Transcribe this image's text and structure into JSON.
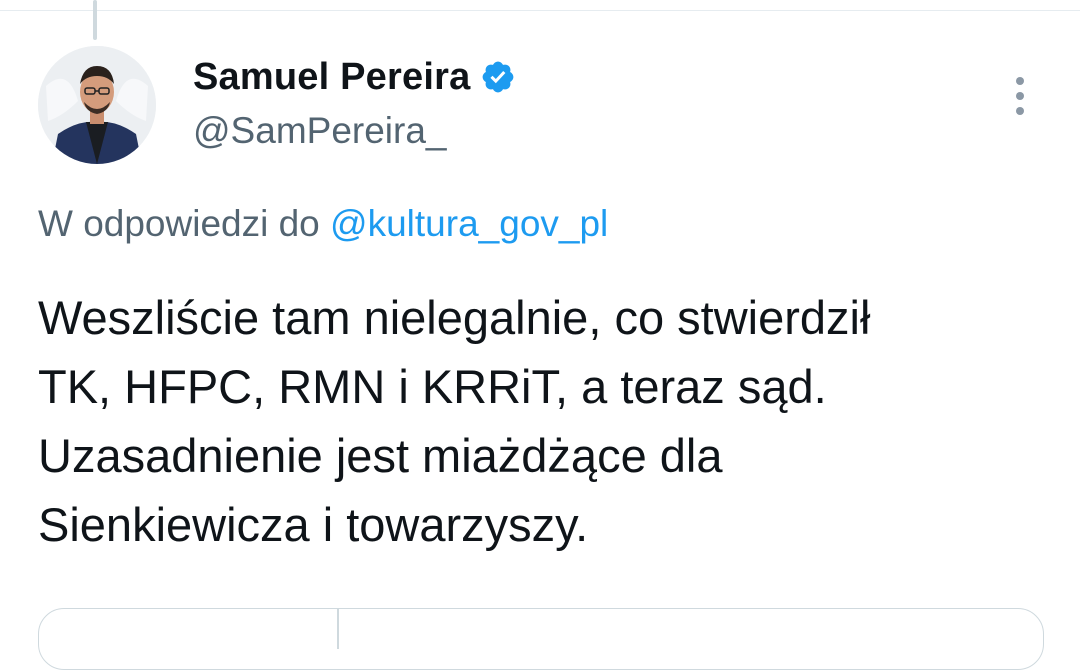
{
  "tweet": {
    "author": {
      "display_name": "Samuel Pereira",
      "handle": "@SamPereira_",
      "verified": true,
      "verified_color": "#1d9bf0"
    },
    "reply_context": {
      "prefix": "W odpowiedzi do",
      "mention": "@kultura_gov_pl"
    },
    "text_lines": [
      "Weszliście tam nielegalnie, co stwierdził",
      "TK, HFPC, RMN i KRRiT, a teraz sąd.",
      "Uzasadnienie jest miażdżące dla",
      "Sienkiewicza i towarzyszy."
    ]
  },
  "icons": {
    "avatar": "user-avatar",
    "verified": "verified-badge-icon",
    "more": "more-options-vertical-icon"
  },
  "colors": {
    "accent": "#1d9bf0",
    "secondary_text": "#536471",
    "primary_text": "#0f1419"
  }
}
